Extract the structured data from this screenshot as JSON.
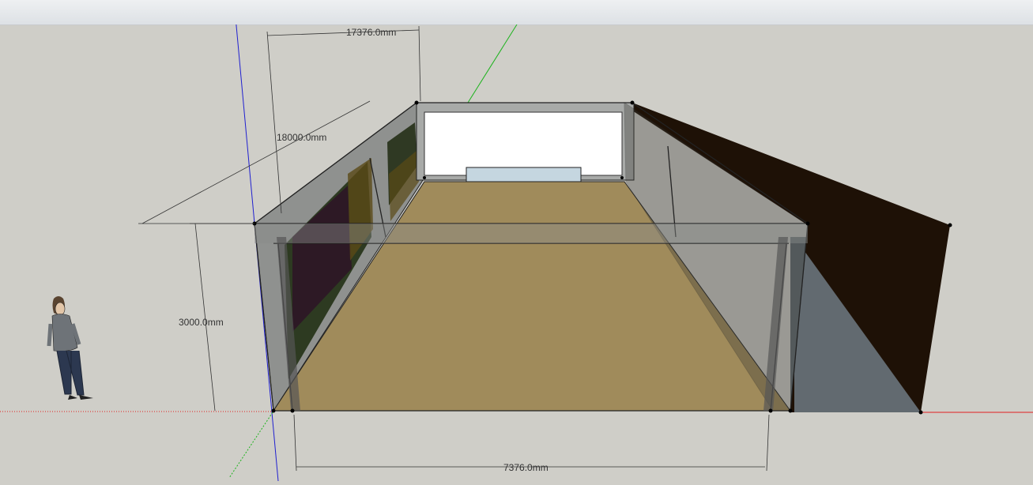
{
  "window": {
    "toolbar": ""
  },
  "dimensions": {
    "top_width": "17376.0mm",
    "depth": "18000.0mm",
    "height": "3000.0mm",
    "bottom_width": "7376.0mm"
  },
  "colors": {
    "background": "#cfcec8",
    "floor": "#a08b5b",
    "dark_wall": "#1e1106",
    "shadow": "#626a70",
    "back_window": "#ffffff",
    "cabinet": "#c5d6e0",
    "axis_red": "#e02020",
    "axis_green": "#1db31d",
    "axis_blue": "#2020d0"
  },
  "icons": {
    "scale_figure": "standing-person-icon"
  }
}
